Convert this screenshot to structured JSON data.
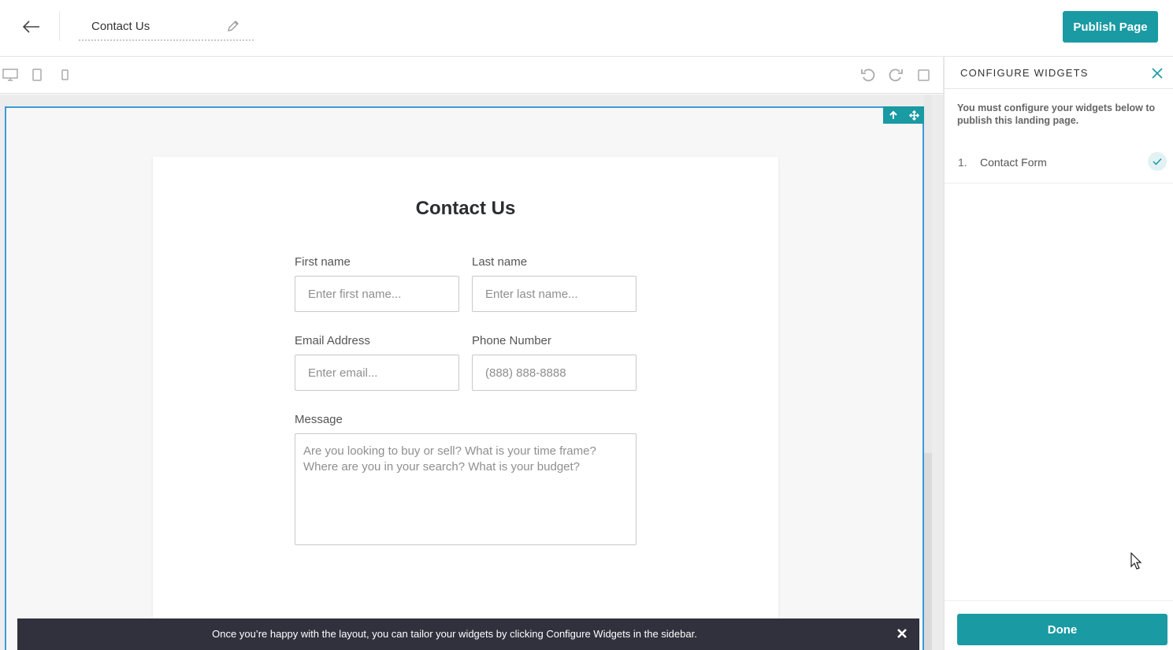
{
  "header": {
    "page_title": "Contact Us",
    "publish_label": "Publish Page"
  },
  "toolbar": {
    "icons": [
      "desktop-icon",
      "tablet-icon",
      "mobile-icon",
      "undo-icon",
      "redo-icon",
      "fullscreen-icon"
    ]
  },
  "form": {
    "title": "Contact Us",
    "first_name": {
      "label": "First name",
      "placeholder": "Enter first name..."
    },
    "last_name": {
      "label": "Last name",
      "placeholder": "Enter last name..."
    },
    "email": {
      "label": "Email Address",
      "placeholder": "Enter email..."
    },
    "phone": {
      "label": "Phone Number",
      "placeholder": "(888) 888-8888"
    },
    "message": {
      "label": "Message",
      "placeholder": "Are you looking to buy or sell? What is your time frame? Where are you in your search? What is your budget?"
    }
  },
  "banner": {
    "text": "Once you’re happy with the layout, you can tailor your widgets by clicking Configure Widgets in the sidebar."
  },
  "sidebar": {
    "title": "CONFIGURE WIDGETS",
    "notice": "You must configure your widgets below to publish this landing page.",
    "items": [
      {
        "number": "1.",
        "label": "Contact Form",
        "status": "configured"
      }
    ],
    "done_label": "Done"
  },
  "colors": {
    "accent": "#1a9aa3",
    "selection": "#3b9ad9",
    "banner_bg": "#30313d"
  }
}
